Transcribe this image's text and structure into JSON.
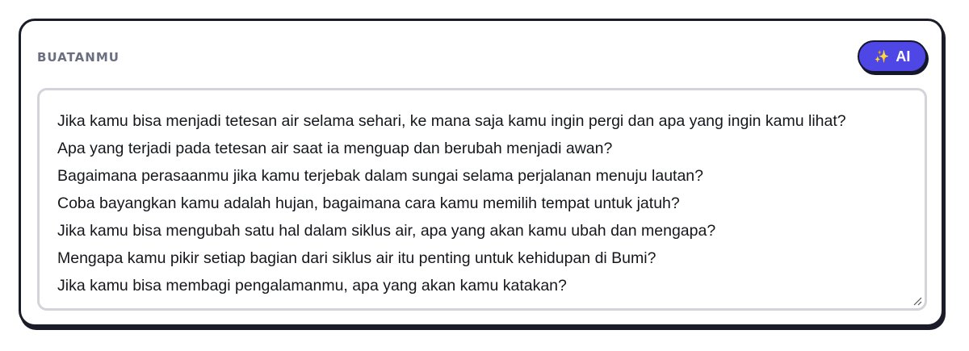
{
  "section": {
    "label": "BUATANMU"
  },
  "ai_button": {
    "icon": "sparkle-icon",
    "label": "AI",
    "color": "#4e46e5"
  },
  "textarea": {
    "value": "Jika kamu bisa menjadi tetesan air selama sehari, ke mana saja kamu ingin pergi dan apa yang ingin kamu lihat?\nApa yang terjadi pada tetesan air saat ia menguap dan berubah menjadi awan?\nBagaimana perasaanmu jika kamu terjebak dalam sungai selama perjalanan menuju lautan?\nCoba bayangkan kamu adalah hujan, bagaimana cara kamu memilih tempat untuk jatuh?\nJika kamu bisa mengubah satu hal dalam siklus air, apa yang akan kamu ubah dan mengapa?\nMengapa kamu pikir setiap bagian dari siklus air itu penting untuk kehidupan di Bumi?\nJika kamu bisa membagi pengalamanmu, apa yang akan kamu katakan?"
  }
}
